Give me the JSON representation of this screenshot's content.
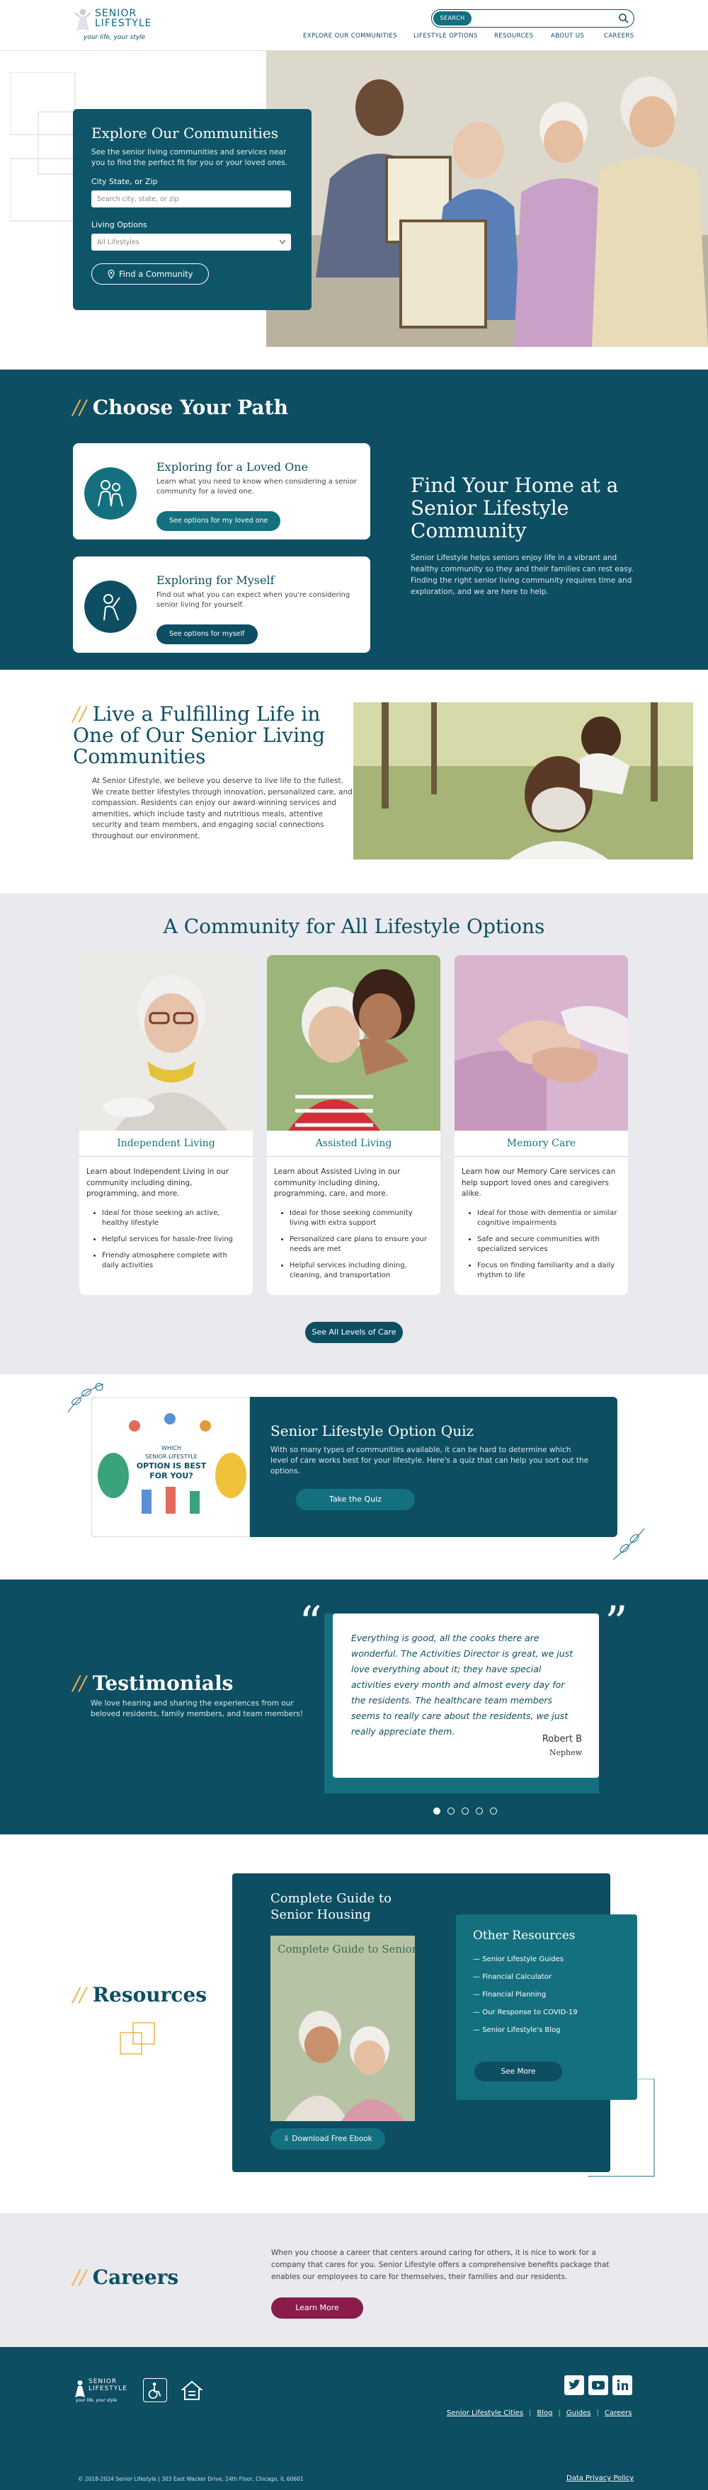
{
  "brand": {
    "name_line1": "SENIOR",
    "name_line2": "LIFESTYLE",
    "tagline": "your life, your style"
  },
  "header": {
    "search_label": "SEARCH",
    "search_placeholder": "",
    "nav": [
      "EXPLORE OUR COMMUNITIES",
      "LIFESTYLE OPTIONS",
      "RESOURCES",
      "ABOUT US",
      "CAREERS"
    ]
  },
  "hero": {
    "title": "Explore Our Communities",
    "description": "See the senior living communities and services near you to find the perfect fit for you or your loved ones.",
    "city_label": "City State, or Zip",
    "city_placeholder": "Search city, state, or zip",
    "living_label": "Living Options",
    "living_selected": "All Lifestyles",
    "find_button": "Find a Community"
  },
  "path": {
    "title": "Choose Your Path",
    "cards": [
      {
        "title": "Exploring for a Loved One",
        "text": "Learn what you need to know when considering a senior community for a loved one.",
        "button": "See options for my loved one"
      },
      {
        "title": "Exploring for Myself",
        "text": "Find out what you can expect when you're considering senior living for yourself.",
        "button": "See options for myself"
      }
    ],
    "right_title": "Find Your Home at a Senior Lifestyle Community",
    "right_text": "Senior Lifestyle helps seniors enjoy life in a vibrant and healthy community so they and their families can rest easy. Finding the right senior living community requires time and exploration, and we are here to help."
  },
  "fulfill": {
    "title": "Live a Fulfilling Life in One of Our Senior Living Communities",
    "text": "At Senior Lifestyle, we believe you deserve to live life to the fullest. We create better lifestyles through innovation, personalized care, and compassion. Residents can enjoy our award-winning services and amenities, which include tasty and nutritious meals, attentive security and team members, and engaging social connections throughout our environment."
  },
  "community": {
    "title": "A Community for All Lifestyle Options",
    "cards": [
      {
        "title": "Independent Living",
        "text": "Learn about Independent Living in our community including dining, programming, and more.",
        "bullets": [
          "Ideal for those seeking an active, healthy lifestyle",
          "Helpful services for hassle-free living",
          "Friendly atmosphere complete with daily activities"
        ]
      },
      {
        "title": "Assisted Living",
        "text": "Learn about Assisted Living in our community including dining, programming, care, and more.",
        "bullets": [
          "Ideal for those seeking community living with extra support",
          "Personalized care plans to ensure your needs are met",
          "Helpful services including dining, cleaning, and transportation"
        ]
      },
      {
        "title": "Memory Care",
        "text": "Learn how our Memory Care services can help support loved ones and caregivers alike.",
        "bullets": [
          "Ideal for those with dementia or similar cognitive impairments",
          "Safe and secure communities with specialized services",
          "Focus on finding familiarity and a daily rhythm to life"
        ]
      }
    ],
    "button": "See All Levels of Care"
  },
  "quiz": {
    "title": "Senior Lifestyle Option Quiz",
    "text": "With so many types of communities available, it can be hard to determine which level of care works best for your lifestyle. Here's a quiz that can help you sort out the options.",
    "button": "Take the Quiz",
    "img_line1": "WHICH",
    "img_line2": "SENIOR LIFESTYLE",
    "img_line3": "OPTION IS BEST",
    "img_line4": "FOR YOU?"
  },
  "testimonials": {
    "title": "Testimonials",
    "sub": "We love hearing and sharing the experiences from our beloved residents, family members, and team members!",
    "quote": "Everything is good, all the cooks there are wonderful. The Activities Director is great, we just love everything about it; they have special activities every month and almost every day for the residents. The healthcare team members seems to really care about the residents, we just really appreciate them.",
    "author": "Robert B",
    "relation": "Nephew",
    "active_dot": 0,
    "dot_count": 5
  },
  "resources": {
    "title": "Resources",
    "guide_title": "Complete Guide to Senior Housing",
    "book_title": "Complete Guide to Senior Housing",
    "download": "Download Free Ebook",
    "other_title": "Other Resources",
    "other_items": [
      "Senior Lifestyle Guides",
      "Financial Calculator",
      "Financial Planning",
      "Our Response to COVID-19",
      "Senior Lifestyle's Blog"
    ],
    "see_more": "See More"
  },
  "careers": {
    "title": "Careers",
    "text": "When you choose a career that centers around caring for others, it is nice to work for a company that cares for you. Senior Lifestyle offers a comprehensive benefits package that enables our employees to care for themselves, their families and our residents.",
    "button": "Learn More"
  },
  "footer": {
    "links": [
      "Senior Lifestyle Cities",
      "Blog",
      "Guides",
      "Careers"
    ],
    "copyright": "© 2018-2024 Senior Lifestyle | 303 East Wacker Drive, 24th Floor, Chicago, IL 60601",
    "privacy": "Data Privacy Policy"
  },
  "colors": {
    "primary": "#0d4e63",
    "secondary": "#14707f",
    "accent": "#f0b34a",
    "careers_button": "#8a1c4b"
  }
}
